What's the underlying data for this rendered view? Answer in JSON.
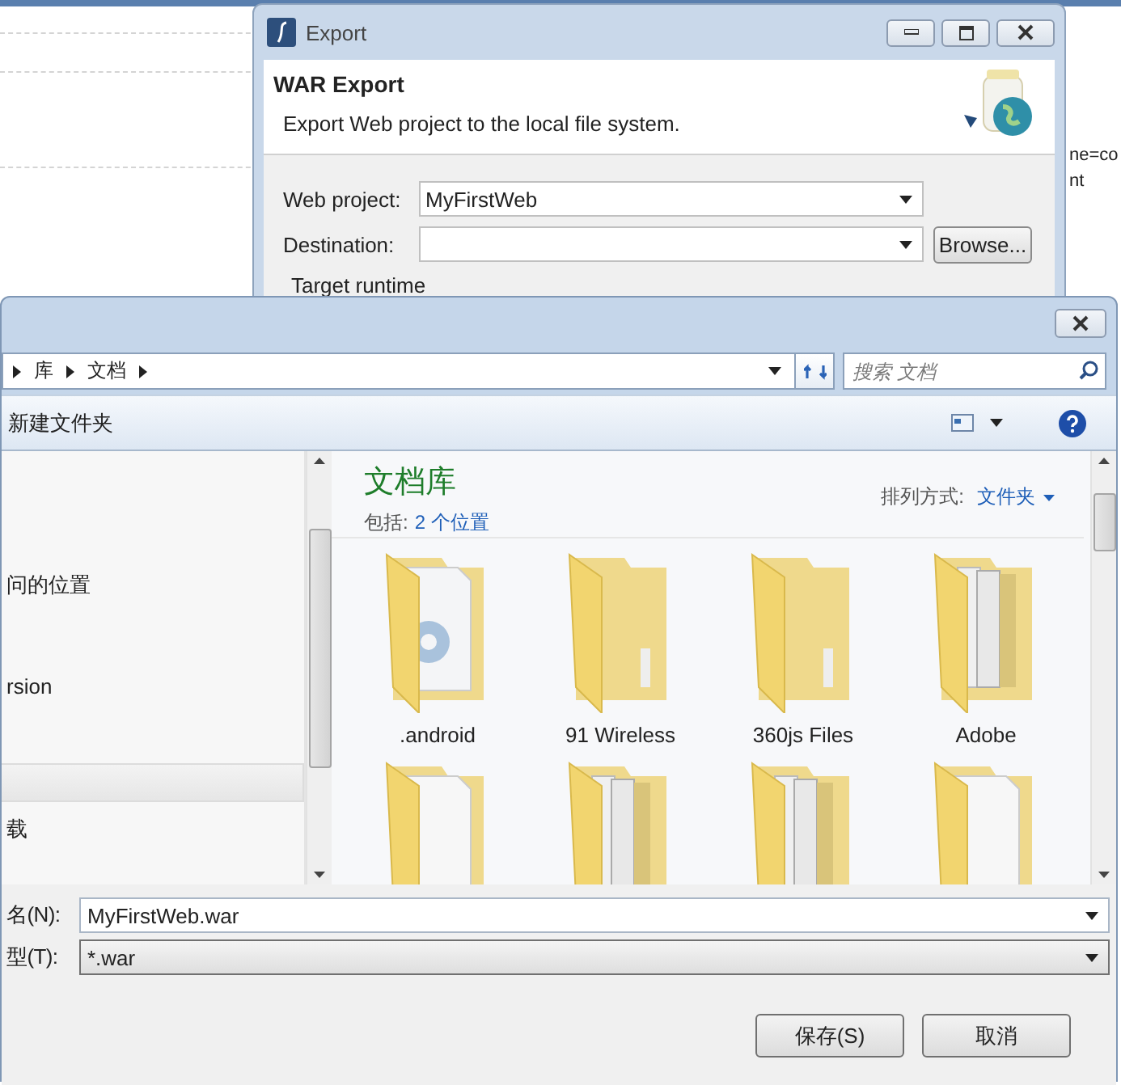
{
  "background_editor": {
    "text_lines": [
      "ne=co",
      "nt"
    ]
  },
  "export_dialog": {
    "title": "Export",
    "heading": "WAR Export",
    "description": "Export Web project to the local file system.",
    "fields": [
      {
        "label": "Web project:",
        "value": "MyFirstWeb"
      },
      {
        "label": "Destination:"
      }
    ],
    "browse_button": "Browse...",
    "section_label": "Target runtime"
  },
  "save_dialog": {
    "breadcrumb": [
      "库",
      "文档"
    ],
    "search": {
      "placeholder": "搜索 文档"
    },
    "toolbar": {
      "new_folder": "新建文件夹"
    },
    "nav_items": [
      {
        "label": "问的位置"
      },
      {
        "label": "rsion"
      },
      {
        "label": "载"
      }
    ],
    "library": {
      "title": "文档库",
      "includes_label": "包括:",
      "includes_link": "2 个位置",
      "arrange_label": "排列方式:",
      "arrange_value": "文件夹"
    },
    "folders": [
      {
        "name": ".android",
        "kind": "gear"
      },
      {
        "name": "91 Wireless",
        "kind": "plain"
      },
      {
        "name": "360js Files",
        "kind": "plain"
      },
      {
        "name": "Adobe",
        "kind": "papers"
      },
      {
        "kind": "paper"
      },
      {
        "kind": "papers"
      },
      {
        "kind": "papers"
      },
      {
        "kind": "paper"
      }
    ],
    "file_name": {
      "label": "名(N):",
      "value": "MyFirstWeb.war"
    },
    "file_type": {
      "label": "型(T):",
      "value": "*.war"
    },
    "buttons": [
      "保存(S)",
      "取消"
    ]
  }
}
